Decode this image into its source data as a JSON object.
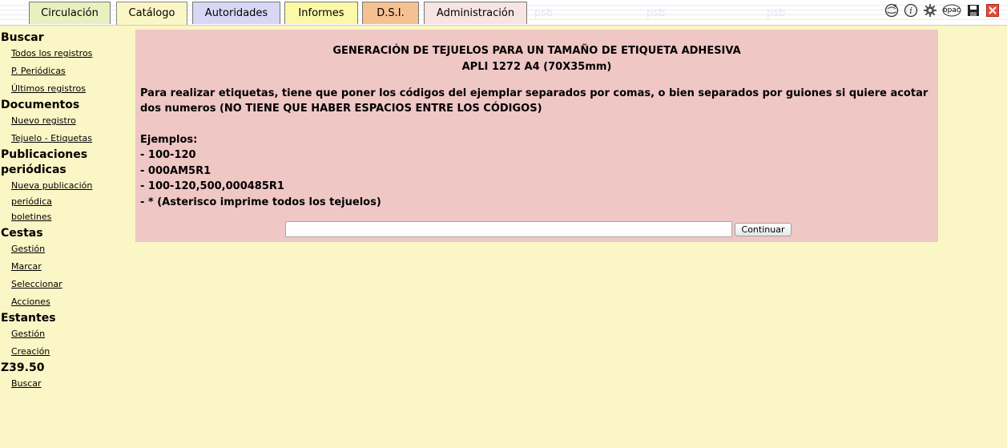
{
  "tabs": [
    {
      "label": "Circulación",
      "color": "#e8f0c0"
    },
    {
      "label": "Catálogo",
      "color": "#fbf6c5"
    },
    {
      "label": "Autoridades",
      "color": "#d8d8f6"
    },
    {
      "label": "Informes",
      "color": "#fbf9a8"
    },
    {
      "label": "D.S.I.",
      "color": "#f6c191"
    },
    {
      "label": "Administración",
      "color": "#f8e4e2"
    }
  ],
  "watermark": "psb",
  "toolbar_icons": [
    "help-globe-icon",
    "info-icon",
    "gear-icon",
    "opac-icon",
    "save-icon",
    "close-icon"
  ],
  "opac_label": "opac",
  "sidebar": {
    "sections": [
      {
        "title": "Buscar",
        "links": [
          "Todos los registros",
          "P. Periódicas",
          "Últimos registros"
        ]
      },
      {
        "title": "Documentos",
        "links": [
          "Nuevo registro",
          "Tejuelo - Etiquetas"
        ]
      },
      {
        "title": "Publicaciones periódicas",
        "links": [
          "Nueva publicación periódica",
          "boletines"
        ]
      },
      {
        "title": "Cestas",
        "links": [
          "Gestión",
          "Marcar",
          "Seleccionar",
          "Acciones"
        ]
      },
      {
        "title": "Estantes",
        "links": [
          "Gestión",
          "Creación"
        ]
      },
      {
        "title": "Z39.50",
        "links": [
          "Buscar"
        ]
      }
    ]
  },
  "main": {
    "heading_line1": "GENERACIÓN DE TEJUELOS PARA UN TAMAÑO DE ETIQUETA ADHESIVA",
    "heading_line2": "APLI 1272 A4 (70X35mm)",
    "instructions": "Para realizar etiquetas, tiene que poner los códigos del ejemplar separados por comas, o bien separados por guiones si quiere acotar dos numeros (NO TIENE QUE HABER ESPACIOS ENTRE LOS CÓDIGOS)",
    "examples_title": "Ejemplos:",
    "examples": [
      "- 100-120",
      "- 000AM5R1",
      "- 100-120,500,000485R1",
      "- * (Asterisco imprime todos los tejuelos)"
    ],
    "input_value": "",
    "continue_label": "Continuar"
  }
}
